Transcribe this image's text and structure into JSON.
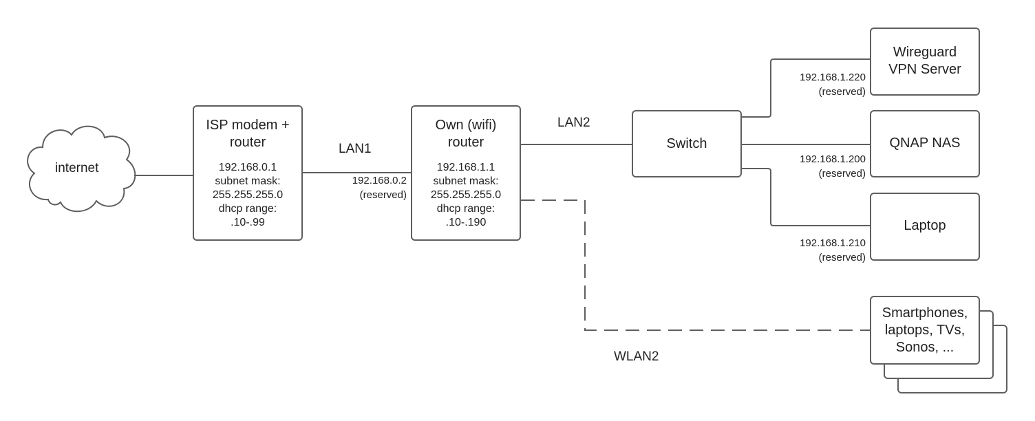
{
  "nodes": {
    "internet": {
      "title": "internet"
    },
    "isp_router": {
      "title_line1": "ISP modem +",
      "title_line2": "router",
      "details": [
        "192.168.0.1",
        "subnet mask:",
        "255.255.255.0",
        "dhcp range:",
        ".10-.99"
      ]
    },
    "own_router": {
      "title_line1": "Own (wifi)",
      "title_line2": "router",
      "details": [
        "192.168.1.1",
        "subnet mask:",
        "255.255.255.0",
        "dhcp range:",
        ".10-.190"
      ]
    },
    "switch": {
      "title": "Switch"
    },
    "wireguard": {
      "title_line1": "Wireguard",
      "title_line2": "VPN Server"
    },
    "nas": {
      "title": "QNAP NAS"
    },
    "laptop": {
      "title": "Laptop"
    },
    "wireless_devices": {
      "lines": [
        "Smartphones,",
        "laptops, TVs,",
        "Sonos, ..."
      ]
    }
  },
  "links": {
    "lan1": {
      "label": "LAN1",
      "ip": "192.168.0.2",
      "note": "(reserved)"
    },
    "lan2": {
      "label": "LAN2"
    },
    "wlan2": {
      "label": "WLAN2"
    },
    "wireguard": {
      "ip": "192.168.1.220",
      "note": "(reserved)"
    },
    "nas": {
      "ip": "192.168.1.200",
      "note": "(reserved)"
    },
    "laptop": {
      "ip": "192.168.1.210",
      "note": "(reserved)"
    }
  },
  "colors": {
    "stroke": "#5e5e5e",
    "text": "#222222"
  }
}
